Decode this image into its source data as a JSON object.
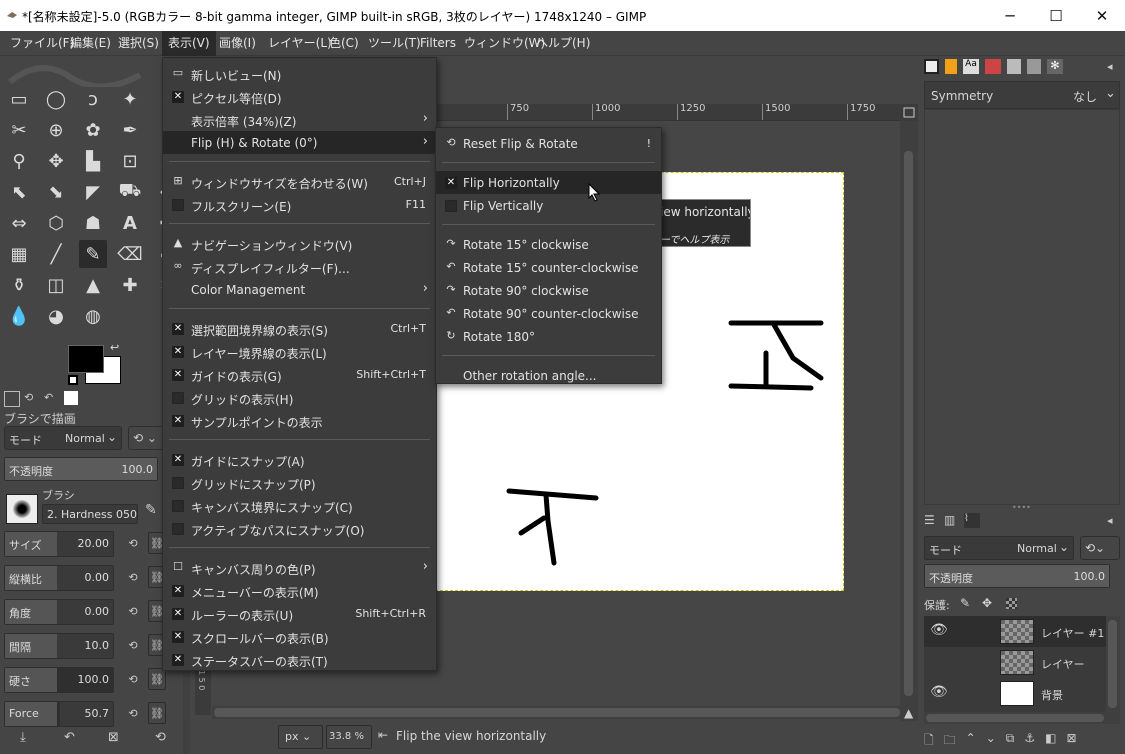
{
  "window": {
    "title": "*[名称未設定]-5.0 (RGBカラー 8-bit gamma integer, GIMP built-in sRGB, 3枚のレイヤー) 1748x1240 – GIMP",
    "minimize": "─",
    "maximize": "☐",
    "close": "✕"
  },
  "menubar": [
    "ファイル(F)",
    "編集(E)",
    "選択(S)",
    "表示(V)",
    "画像(I)",
    "レイヤー(L)",
    "色(C)",
    "ツール(T)",
    "Filters",
    "ウィンドウ(W)",
    "ヘルプ(H)"
  ],
  "tool_options": {
    "tab_title": "ブラシで描画",
    "mode_label": "モード",
    "mode_value": "Normal",
    "opacity_label": "不透明度",
    "opacity_value": "100.0",
    "brush_label": "ブラシ",
    "brush_value": "2. Hardness 050",
    "size_label": "サイズ",
    "size_value": "20.00",
    "aspect_label": "縦横比",
    "aspect_value": "0.00",
    "angle_label": "角度",
    "angle_value": "0.00",
    "spacing_label": "間隔",
    "spacing_value": "10.0",
    "hardness_label": "硬さ",
    "hardness_value": "100.0",
    "force_label": "Force",
    "force_value": "50.7",
    "fill": {
      "size": 0.2,
      "aspect": 0.0,
      "angle": 0.0,
      "spacing": 0.1,
      "hardness": 1.0,
      "force": 0.507
    }
  },
  "ruler_ticks": [
    "750",
    "1000",
    "1250",
    "1500",
    "1750"
  ],
  "view_menu": [
    {
      "type": "item",
      "icon": "new-view-icon",
      "label": "新しいビュー(N)",
      "accel": ""
    },
    {
      "type": "check",
      "checked": true,
      "label": "ピクセル等倍(D)",
      "accel": ""
    },
    {
      "type": "submenu",
      "label": "表示倍率 (34%)(Z)"
    },
    {
      "type": "submenu",
      "label": "Flip (H) & Rotate (0°)",
      "hl": true
    },
    {
      "type": "sep"
    },
    {
      "type": "item",
      "icon": "fit-window-icon",
      "label": "ウィンドウサイズを合わせる(W)",
      "accel": "Ctrl+J"
    },
    {
      "type": "check",
      "checked": false,
      "label": "フルスクリーン(E)",
      "accel": "F11"
    },
    {
      "type": "sep"
    },
    {
      "type": "item",
      "icon": "navigation-icon",
      "label": "ナビゲーションウィンドウ(V)",
      "accel": ""
    },
    {
      "type": "item",
      "icon": "display-filter-icon",
      "label": "ディスプレイフィルター(F)...",
      "accel": ""
    },
    {
      "type": "submenu",
      "label": "Color Management"
    },
    {
      "type": "sep"
    },
    {
      "type": "check",
      "checked": true,
      "label": "選択範囲境界線の表示(S)",
      "accel": "Ctrl+T"
    },
    {
      "type": "check",
      "checked": true,
      "label": "レイヤー境界線の表示(L)",
      "accel": ""
    },
    {
      "type": "check",
      "checked": true,
      "label": "ガイドの表示(G)",
      "accel": "Shift+Ctrl+T"
    },
    {
      "type": "check",
      "checked": false,
      "label": "グリッドの表示(H)",
      "accel": ""
    },
    {
      "type": "check",
      "checked": true,
      "label": "サンプルポイントの表示",
      "accel": ""
    },
    {
      "type": "sep"
    },
    {
      "type": "check",
      "checked": true,
      "label": "ガイドにスナップ(A)",
      "accel": ""
    },
    {
      "type": "check",
      "checked": false,
      "label": "グリッドにスナップ(P)",
      "accel": ""
    },
    {
      "type": "check",
      "checked": false,
      "label": "キャンバス境界にスナップ(C)",
      "accel": ""
    },
    {
      "type": "check",
      "checked": false,
      "label": "アクティブなパスにスナップ(O)",
      "accel": ""
    },
    {
      "type": "sep"
    },
    {
      "type": "submenu",
      "icon": "padding-color-icon",
      "label": "キャンバス周りの色(P)"
    },
    {
      "type": "check",
      "checked": true,
      "label": "メニューバーの表示(M)",
      "accel": ""
    },
    {
      "type": "check",
      "checked": true,
      "label": "ルーラーの表示(U)",
      "accel": "Shift+Ctrl+R"
    },
    {
      "type": "check",
      "checked": true,
      "label": "スクロールバーの表示(B)",
      "accel": ""
    },
    {
      "type": "check",
      "checked": true,
      "label": "ステータスバーの表示(T)",
      "accel": ""
    }
  ],
  "flip_menu": [
    {
      "type": "item",
      "icon": "reset-icon",
      "label": "Reset Flip & Rotate",
      "accel": "!"
    },
    {
      "type": "sep"
    },
    {
      "type": "check",
      "checked": true,
      "label": "Flip Horizontally",
      "hl": true
    },
    {
      "type": "check",
      "checked": false,
      "label": "Flip Vertically"
    },
    {
      "type": "sep"
    },
    {
      "type": "item",
      "icon": "rotate-cw-icon",
      "label": "Rotate 15° clockwise"
    },
    {
      "type": "item",
      "icon": "rotate-ccw-icon",
      "label": "Rotate 15° counter-clockwise"
    },
    {
      "type": "item",
      "icon": "rotate-cw-icon",
      "label": "Rotate 90° clockwise"
    },
    {
      "type": "item",
      "icon": "rotate-ccw-icon",
      "label": "Rotate 90° counter-clockwise"
    },
    {
      "type": "item",
      "icon": "rotate-180-icon",
      "label": "Rotate 180°"
    },
    {
      "type": "sep"
    },
    {
      "type": "item",
      "label": "Other rotation angle..."
    }
  ],
  "tooltip": {
    "line1": "Flip the view horizontally",
    "line2": "F1キーでヘルプ表示",
    "visible1": "iew horizontally",
    "visible2": "ーでヘルプ表示"
  },
  "symmetry": {
    "title": "Symmetry",
    "value": "なし"
  },
  "layers": {
    "mode_label": "モード",
    "mode_value": "Normal",
    "opacity_label": "不透明度",
    "opacity_value": "100.0",
    "lock_label": "保護:",
    "items": [
      "レイヤー #1",
      "レイヤー",
      "背景"
    ]
  },
  "statusbar": {
    "unit": "px",
    "zoom": "33.8 %",
    "message": "Flip the view horizontally"
  },
  "colors": {
    "accent": "#d2c20f"
  }
}
